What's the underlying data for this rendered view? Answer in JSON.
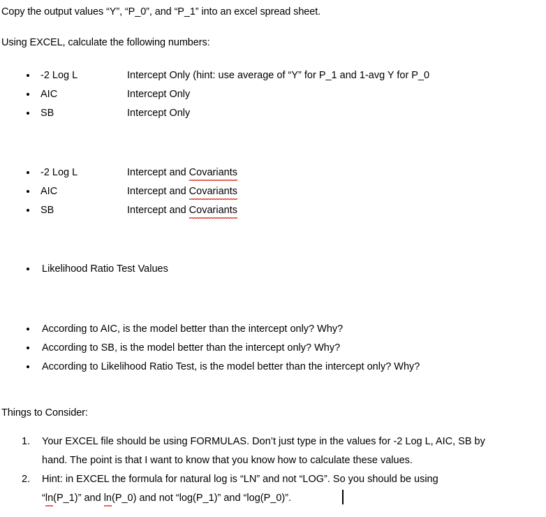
{
  "document": {
    "background_color": "#ffffff",
    "text_color": "#000000",
    "spellcheck_underline_color": "#e02b18",
    "intro": {
      "line1": "Copy the output values “Y”, “P_0”, and “P_1” into an excel spread sheet.",
      "line2": "Using EXCEL, calculate the following numbers:"
    },
    "group_intercept_only": [
      {
        "label": "-2 Log L",
        "detail": "Intercept Only (hint: use average of “Y” for P_1 and 1-avg Y for P_0"
      },
      {
        "label": "AIC",
        "detail": "Intercept Only"
      },
      {
        "label": "SB",
        "detail": "Intercept Only"
      }
    ],
    "group_intercept_and_covariants": [
      {
        "label": "-2 Log L",
        "detail_prefix": "Intercept and ",
        "detail_misspelled": "Covariants"
      },
      {
        "label": "AIC",
        "detail_prefix": "Intercept and ",
        "detail_misspelled": "Covariants"
      },
      {
        "label": "SB",
        "detail_prefix": "Intercept and ",
        "detail_misspelled": "Covariants"
      }
    ],
    "group_likelihood": [
      {
        "label": "Likelihood Ratio Test Values"
      }
    ],
    "group_questions": [
      {
        "text": "According to AIC, is the model better than the intercept only? Why?"
      },
      {
        "text": "According to SB, is the model better than the intercept only? Why?"
      },
      {
        "text": "According to Likelihood Ratio Test, is the model better than the intercept only? Why?"
      }
    ],
    "things_to_consider_heading": "Things to Consider:",
    "numbered_items": [
      {
        "marker": "1.",
        "line1": "Your EXCEL file should be using FORMULAS.  Don’t just type in the values for -2 Log L, AIC, SB by",
        "line2": "hand. The point is that I want to know that you know how to calculate these values."
      },
      {
        "marker": "2.",
        "line1": "Hint: in EXCEL the formula for natural log is “LN” and not “LOG”. So you should be using",
        "line2_part1_quote_open": "“",
        "line2_misspelled_1": "ln",
        "line2_part2": "(P_1)” and ",
        "line2_misspelled_2": "ln",
        "line2_part3": "(P_0) and not “log(P_1)” and “log(P_0)”."
      }
    ]
  }
}
